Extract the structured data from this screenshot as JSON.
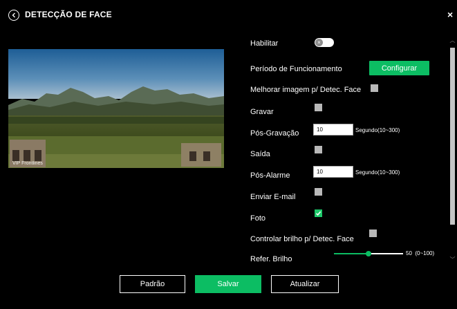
{
  "header": {
    "title": "DETECÇÃO DE FACE",
    "close_label": "×"
  },
  "video": {
    "camera_label": "VIP Frontlines"
  },
  "settings": {
    "enable": {
      "label": "Habilitar",
      "value": false
    },
    "schedule": {
      "label": "Período de Funcionamento",
      "button_label": "Configurar"
    },
    "enhance": {
      "label": "Melhorar imagem p/ Detec. Face",
      "checked": false
    },
    "record": {
      "label": "Gravar",
      "checked": false
    },
    "post_record": {
      "label": "Pós-Gravação",
      "value": "10",
      "unit": "Segundo(10~300)"
    },
    "output": {
      "label": "Saída",
      "checked": false
    },
    "post_alarm": {
      "label": "Pós-Alarme",
      "value": "10",
      "unit": "Segundo(10~300)"
    },
    "email": {
      "label": "Enviar E-mail",
      "checked": false
    },
    "photo": {
      "label": "Foto",
      "checked": true
    },
    "brightness_control": {
      "label": "Controlar brilho p/ Detec. Face",
      "checked": false
    },
    "brightness_ref": {
      "label": "Refer. Brilho",
      "value": 50,
      "value_text": "50",
      "range": "(0~100)"
    }
  },
  "footer": {
    "default_label": "Padrão",
    "save_label": "Salvar",
    "refresh_label": "Atualizar"
  },
  "colors": {
    "accent": "#0cbd63",
    "background": "#000000",
    "checkbox_off": "#b9b9b9"
  }
}
